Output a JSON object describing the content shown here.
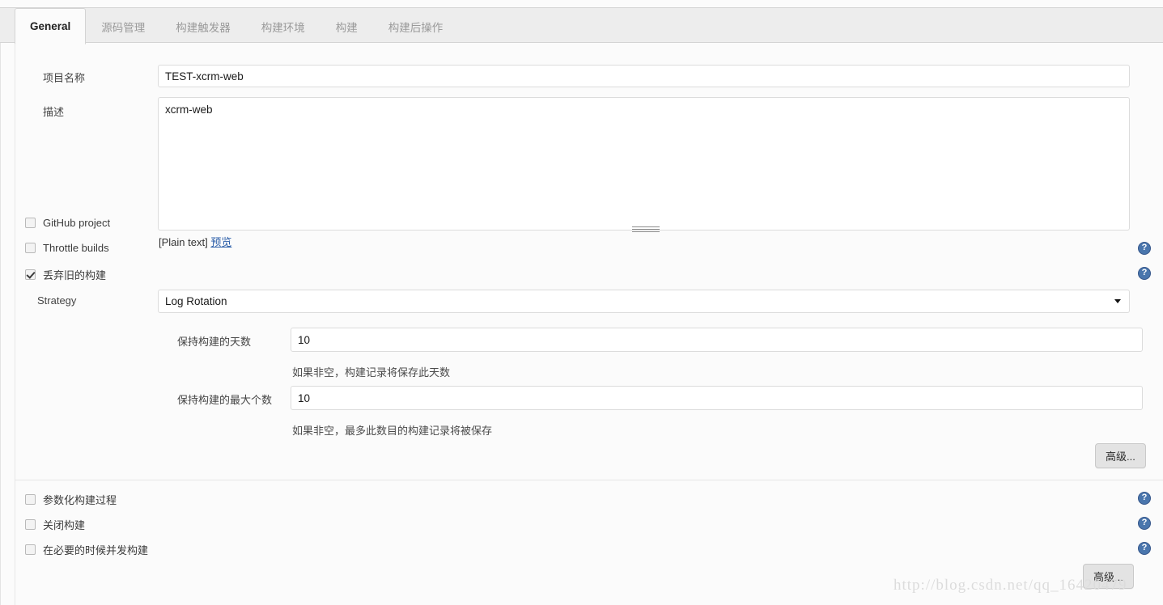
{
  "tabs": [
    {
      "label": "General",
      "active": true
    },
    {
      "label": "源码管理",
      "active": false
    },
    {
      "label": "构建触发器",
      "active": false
    },
    {
      "label": "构建环境",
      "active": false
    },
    {
      "label": "构建",
      "active": false
    },
    {
      "label": "构建后操作",
      "active": false
    }
  ],
  "form": {
    "project_name": {
      "label": "项目名称",
      "value": "TEST-xcrm-web",
      "placeholder": ""
    },
    "description": {
      "label": "描述",
      "value": "xcrm-web",
      "placeholder": "",
      "markup_note": "[Plain text]",
      "preview_link": "预览"
    }
  },
  "checkboxes": {
    "github_project": {
      "label": "GitHub project",
      "checked": false,
      "help": "help-icon"
    },
    "throttle_builds": {
      "label": "Throttle builds",
      "checked": false,
      "help": "help-icon"
    },
    "discard_old_builds": {
      "label": "丢弃旧的构建",
      "checked": true,
      "help": "help-icon"
    },
    "parameterized_build": {
      "label": "参数化构建过程",
      "checked": false,
      "help": "help-icon"
    },
    "disable_build": {
      "label": "关闭构建",
      "checked": false,
      "help": "help-icon"
    },
    "concurrent_builds": {
      "label": "在必要的时候并发构建",
      "checked": false,
      "help": "help-icon"
    }
  },
  "discard_section": {
    "strategy": {
      "label": "Strategy",
      "selected": "Log Rotation",
      "options": [
        "Log Rotation"
      ]
    },
    "days_to_keep": {
      "label": "保持构建的天数",
      "value": "10",
      "hint": "如果非空，构建记录将保存此天数"
    },
    "num_to_keep": {
      "label": "保持构建的最大个数",
      "value": "10",
      "hint": "如果非空，最多此数目的构建记录将被保存"
    },
    "advanced_button": "高级..."
  },
  "footer": {
    "advanced_button": "高级..."
  },
  "watermark": {
    "text": "http://blog.csdn.net/qq_16420479"
  },
  "colors": {
    "page_background": "#fbfbfb",
    "tabbar_background": "#ededed",
    "border": "#d4d4d4",
    "link": "#2b5ea8",
    "help_icon": "#4a76ad",
    "button_face": "#e3e3e3",
    "watermark": "#dcdcdc"
  }
}
